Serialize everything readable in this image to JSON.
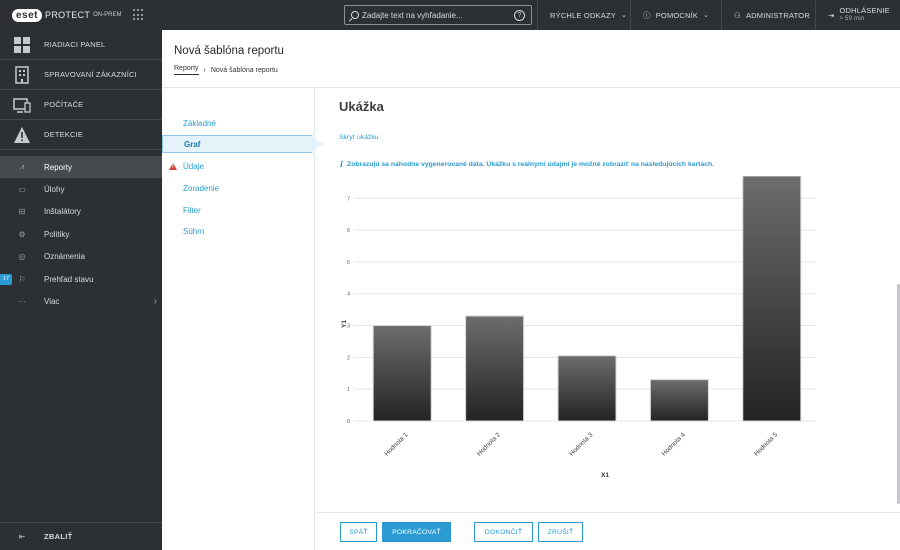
{
  "app": {
    "logo": "eset",
    "product": "PROTECT",
    "product_sub": "ON-PREM"
  },
  "topbar": {
    "search_placeholder": "Zadajte text na vyhľadanie...",
    "help_icon": "?",
    "quick_links": "RÝCHLE ODKAZY",
    "helper": "POMOCNÍK",
    "user": "ADMINISTRATOR",
    "logout": "ODHLÁSENIE",
    "logout_sub": "> 59 min"
  },
  "sidebar": {
    "main_items": [
      {
        "label": "RIADIACI PANEL",
        "icon": "dashboard-icon"
      },
      {
        "label": "SPRAVOVANÍ ZÁKAZNÍCI",
        "icon": "building-icon"
      },
      {
        "label": "POČÍTAČE",
        "icon": "computer-icon"
      },
      {
        "label": "DETEKCIE",
        "icon": "warning-icon"
      }
    ],
    "sub_items": [
      {
        "label": "Reporty",
        "icon": "chart-icon",
        "active": true
      },
      {
        "label": "Úlohy",
        "icon": "tasks-icon"
      },
      {
        "label": "Inštalátory",
        "icon": "installer-icon"
      },
      {
        "label": "Politiky",
        "icon": "policy-icon"
      },
      {
        "label": "Oznámenia",
        "icon": "notification-icon"
      },
      {
        "label": "Prehľad stavu",
        "icon": "status-icon",
        "badge": "17"
      },
      {
        "label": "Viac",
        "icon": "more-icon"
      }
    ],
    "collapse": "ZBALIŤ"
  },
  "header": {
    "title": "Nová šablóna reportu",
    "breadcrumb_root": "Reporty",
    "breadcrumb_current": "Nová šablóna reportu"
  },
  "steps": [
    {
      "label": "Základné"
    },
    {
      "label": "Graf",
      "active": true
    },
    {
      "label": "Údaje",
      "warning": true
    },
    {
      "label": "Zoradenie"
    },
    {
      "label": "Filter"
    },
    {
      "label": "Súhrn"
    }
  ],
  "main": {
    "section_title": "Ukážka",
    "hide_link": "Skryť ukážku",
    "info_text": "Zobrazujú sa náhodne vygenerované dáta. Ukážku s reálnymi údajmi je možné zobraziť na nasledujúcich kartách."
  },
  "chart_data": {
    "type": "bar",
    "categories": [
      "Hodnota 1",
      "Hodnota 2",
      "Hodnota 3",
      "Hodnota 4",
      "Hodnota 5"
    ],
    "values": [
      3.0,
      3.3,
      2.05,
      1.3,
      7.7
    ],
    "xlabel": "X1",
    "ylabel": "Y1",
    "yticks": [
      0,
      1,
      2,
      3,
      4,
      5,
      6,
      7
    ],
    "ylim": [
      0,
      7.7
    ],
    "grid": true
  },
  "footer": {
    "back": "SPÄŤ",
    "continue": "POKRAČOVAŤ",
    "finish": "DOKONČIŤ",
    "cancel": "ZRUŠIŤ"
  }
}
